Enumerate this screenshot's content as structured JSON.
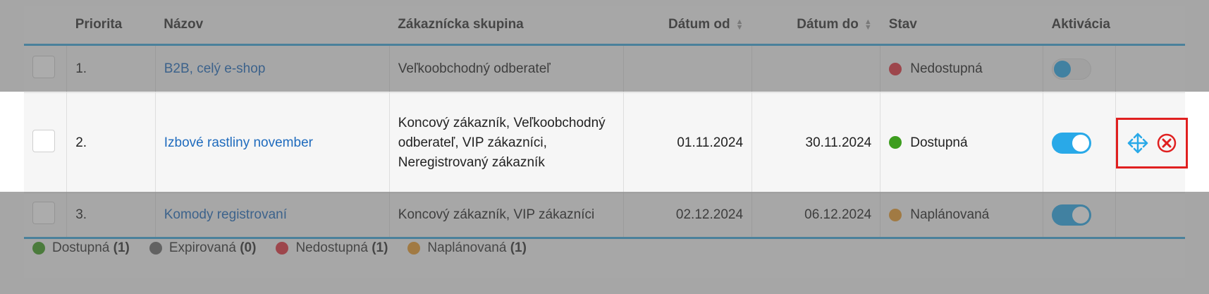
{
  "columns": {
    "priority": "Priorita",
    "name": "Názov",
    "group": "Zákaznícka skupina",
    "date_from": "Dátum od",
    "date_to": "Dátum do",
    "state": "Stav",
    "activation": "Aktivácia"
  },
  "rows": [
    {
      "priority": "1.",
      "name": "B2B, celý e-shop",
      "group": "Veľkoobchodný odberateľ",
      "date_from": "",
      "date_to": "",
      "state": "Nedostupná",
      "state_color": "#e0333f",
      "active": false
    },
    {
      "priority": "2.",
      "name": "Izbové rastliny november",
      "group": "Koncový zákazník, Veľkoobchodný odberateľ, VIP zákazníci, Neregistrovaný zákazník",
      "date_from": "01.11.2024",
      "date_to": "30.11.2024",
      "state": "Dostupná",
      "state_color": "#3d9d1f",
      "active": true
    },
    {
      "priority": "3.",
      "name": "Komody registrovaní",
      "group": "Koncový zákazník, VIP zákazníci",
      "date_from": "02.12.2024",
      "date_to": "06.12.2024",
      "state": "Naplánovaná",
      "state_color": "#e89a2c",
      "active": true
    }
  ],
  "legend": [
    {
      "label": "Dostupná",
      "count": "(1)",
      "color": "#3d9d1f"
    },
    {
      "label": "Expirovaná",
      "count": "(0)",
      "color": "#6a6a6a"
    },
    {
      "label": "Nedostupná",
      "count": "(1)",
      "color": "#e0333f"
    },
    {
      "label": "Naplánovaná",
      "count": "(1)",
      "color": "#e89a2c"
    }
  ],
  "icons": {
    "move": "move-arrows-icon",
    "delete": "close-circle-icon",
    "sort": "sort-icon"
  },
  "colors": {
    "accent": "#29a9e8",
    "link": "#1f6bbd",
    "highlight_border": "#e02020"
  }
}
